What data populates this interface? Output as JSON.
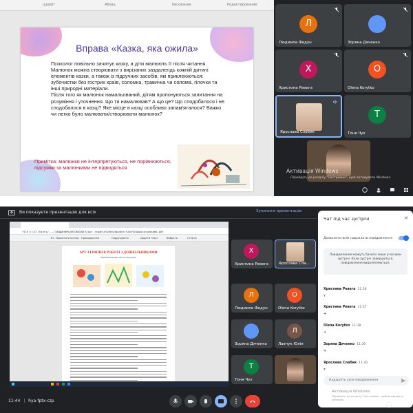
{
  "colors": {
    "meet_bg": "#202124",
    "tile_bg": "#3c4043",
    "title_purple": "#4b3aa6",
    "note_red": "#c0143c",
    "accent_blue": "#1a73e8",
    "end_call_red": "#ea4335"
  },
  "top": {
    "ruler_labels": [
      "шрифт",
      "Абзац",
      "Рисование",
      "Редактирование"
    ],
    "slide": {
      "title": "Вправа «Казка, яка ожила»",
      "body": [
        "Психолог повільно зачитує казку, а діти малюють її після читання.",
        "Малюнок можна створювати з вирізаних заздалегідь кожній дитині елементів казки, а також із підручних засобів, які приклеюються: зубочистки без гострих країв, соломка, травичка чи солома, гілочки та інші природні матеріали.",
        "Після того як малюнок намальований, дітям пропонуються запитання на розуміння і уточнення. Що ти намалював? А що це? Що сподобалося і не сподобалося в казці? Яке місце в казці особливо запам'яталося? Важко чи легко було малювати/створювати малюнок?"
      ],
      "note_label": "Примітка:",
      "note_text": "малюнки не інтерпретуються, не порівнюються, підсумки за малюнками не підводяться"
    },
    "participants": [
      {
        "name": "Людмила Федун",
        "initial": "Л",
        "color": "#e8710a"
      },
      {
        "name": "Зоряна Дяченко",
        "initial": "",
        "color": "#5e97f6"
      },
      {
        "name": "Христина Ревега",
        "initial": "Х",
        "color": "#c2185b"
      },
      {
        "name": "Olena Korytko",
        "initial": "O",
        "color": "#f4511e"
      },
      {
        "name": "Ярослава Слабик",
        "initial": "",
        "color": "#6d6d6d"
      },
      {
        "name": "Тоня Чух",
        "initial": "Т",
        "color": "#0b8043"
      }
    ],
    "watermark_title": "Активація Windows",
    "watermark_sub": "Перейдіть до розділу \"Настройки\", щоб активувати Windows."
  },
  "bottom": {
    "presenting_text": "Ви показуєте презентацію для всіх",
    "stop_presenting": "Зупинити презентацію",
    "shared_doc": {
      "url": "file:///C:/Users/.../ЗАВДАННЯ%20ПСИХОЛОГА/Арт-терапія%20в%20роботі%20з%20дошкільниками.pdf",
      "heading": "АРТ-ТЕРАПІЯ В РОБОТІ З ДОШКІЛЬНИКАМИ",
      "subheading": "Рекомендований список літератури",
      "toolbar": [
        "Вт. Прочитати вголос",
        "Проходження",
        "Надрукувати",
        "Додати текст",
        "Вибрати",
        "Стерти"
      ]
    },
    "participants": [
      {
        "name": "Христина Ревега",
        "initial": "Х",
        "color": "#c2185b"
      },
      {
        "name": "Ярослава Сла...",
        "initial": "",
        "color": "#6d6d6d"
      },
      {
        "name": "Людмила Федун",
        "initial": "Л",
        "color": "#e8710a"
      },
      {
        "name": "Olena Korytko",
        "initial": "O",
        "color": "#f4511e"
      },
      {
        "name": "Зоряна Дяченко",
        "initial": "",
        "color": "#5e97f6"
      },
      {
        "name": "Лавчук Юлія",
        "initial": "Л",
        "color": "#795548"
      },
      {
        "name": "Тоня Чух",
        "initial": "Т",
        "color": "#0b8043"
      },
      {
        "name": "",
        "initial": "",
        "color": "#6b5a4a"
      }
    ],
    "chat": {
      "title": "Чат під час зустрічі",
      "toggle_label": "Дозволити всім надсилати повідомлення",
      "notice": "Повідомлення можуть бачити лише учасники зустрічі. Коли зустріч завершиться, повідомлення видалятимуться.",
      "messages": [
        {
          "who": "Христина Ревега",
          "time": "11:36",
          "text": "т"
        },
        {
          "who": "Христина Ревега",
          "time": "11:37",
          "text": "+"
        },
        {
          "who": "Olena Korytko",
          "time": "11:38",
          "text": "+"
        },
        {
          "who": "Зоряна Дяченко",
          "time": "11:39",
          "text": "+"
        },
        {
          "who": "Ярослава Слабик",
          "time": "11:40",
          "text": "т"
        }
      ],
      "input_placeholder": "Надішліть усім повідомлення",
      "watermark_title": "Активація Windows",
      "watermark_sub": "Перейдіть до розділу \"Настройки\", щоб активувати Windows."
    },
    "meeting_time": "11:44",
    "meeting_code": "hya-fptx-czp"
  }
}
